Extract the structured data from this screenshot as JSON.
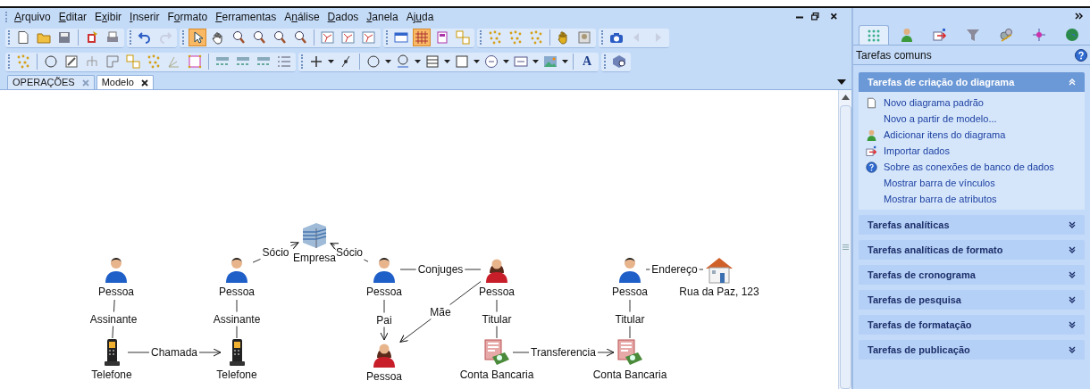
{
  "menu": [
    {
      "access_key": "A",
      "rest": "rquivo"
    },
    {
      "access_key": "E",
      "rest": "ditar"
    },
    {
      "before": "E",
      "access_key": "x",
      "rest": "ibir"
    },
    {
      "access_key": "I",
      "rest": "nserir"
    },
    {
      "before": "F",
      "access_key": "o",
      "rest": "rmato"
    },
    {
      "access_key": "F",
      "rest": "erramentas"
    },
    {
      "before": "A",
      "access_key": "n",
      "rest": "álise"
    },
    {
      "access_key": "D",
      "rest": "ados"
    },
    {
      "access_key": "J",
      "rest": "anela"
    },
    {
      "before": "Aj",
      "access_key": "u",
      "rest": "da"
    }
  ],
  "main_toolbar": [
    {
      "pressed": false,
      "disabled": false
    },
    {
      "pressed": false,
      "disabled": false
    },
    {
      "pressed": false,
      "disabled": false
    },
    {
      "pressed": false,
      "disabled": false
    },
    {
      "pressed": false,
      "disabled": false
    },
    {
      "pressed": false,
      "disabled": false
    },
    {
      "pressed": false,
      "disabled": true
    },
    {
      "pressed": true,
      "disabled": false
    },
    {
      "pressed": false,
      "disabled": false
    },
    {
      "pressed": false,
      "disabled": false
    },
    {
      "pressed": false,
      "disabled": false
    },
    {
      "pressed": false,
      "disabled": false
    },
    {
      "pressed": false,
      "disabled": false
    },
    {
      "pressed": false,
      "disabled": false
    },
    {
      "pressed": false,
      "disabled": false
    },
    {
      "pressed": false,
      "disabled": false
    },
    {
      "pressed": false,
      "disabled": false
    },
    {
      "pressed": true,
      "disabled": false
    },
    {
      "pressed": false,
      "disabled": false
    },
    {
      "pressed": false,
      "disabled": false
    },
    {
      "pressed": false,
      "disabled": false
    },
    {
      "pressed": false,
      "disabled": false
    },
    {
      "pressed": false,
      "disabled": false
    },
    {
      "pressed": false,
      "disabled": false
    },
    {
      "pressed": false,
      "disabled": false
    },
    {
      "pressed": false,
      "disabled": false
    },
    {
      "pressed": false,
      "disabled": true
    },
    {
      "pressed": false,
      "disabled": true
    }
  ],
  "format_toolbar": {
    "font_button": "A"
  },
  "document_tabs": [
    {
      "label": "OPERAÇÕES",
      "selected": false
    },
    {
      "label": "Modelo",
      "selected": true
    }
  ],
  "diagram": {
    "nodes": [
      {
        "kind": "company",
        "label": "Empresa"
      },
      {
        "kind": "man",
        "label": "Pessoa"
      },
      {
        "kind": "man",
        "label": "Pessoa"
      },
      {
        "kind": "man",
        "label": "Pessoa"
      },
      {
        "kind": "woman",
        "label": "Pessoa"
      },
      {
        "kind": "man",
        "label": "Pessoa"
      },
      {
        "kind": "house",
        "label": "Rua da Paz, 123"
      },
      {
        "kind": "phone",
        "label": "Telefone"
      },
      {
        "kind": "phone",
        "label": "Telefone"
      },
      {
        "kind": "woman",
        "label": "Pessoa"
      },
      {
        "kind": "account",
        "label": "Conta Bancaria"
      },
      {
        "kind": "account",
        "label": "Conta Bancaria"
      }
    ],
    "edges": [
      {
        "label": "Sócio",
        "arrow": true
      },
      {
        "label": "Sócio",
        "arrow": true
      },
      {
        "label": "Conjuges",
        "arrow": false
      },
      {
        "label": "Endereço",
        "arrow": false
      },
      {
        "label": "Assinante",
        "arrow": false
      },
      {
        "label": "Assinante",
        "arrow": false
      },
      {
        "label": "Pai",
        "arrow": true
      },
      {
        "label": "Mãe",
        "arrow": true
      },
      {
        "label": "Titular",
        "arrow": false
      },
      {
        "label": "Titular",
        "arrow": false
      },
      {
        "label": "Chamada",
        "arrow": true
      },
      {
        "label": "Transferencia",
        "arrow": true
      }
    ]
  },
  "task_pane": {
    "tabs": [
      {
        "selected": true
      },
      {
        "selected": false
      },
      {
        "selected": false
      },
      {
        "selected": false
      },
      {
        "selected": false
      },
      {
        "selected": false
      },
      {
        "selected": false
      }
    ],
    "title": "Tarefas comuns",
    "sections": [
      {
        "title": "Tarefas de criação do diagrama",
        "expanded": true,
        "items": [
          {
            "kind": "document",
            "label": "Novo diagrama padrão"
          },
          {
            "kind": "plain",
            "label": "Novo a partir de modelo..."
          },
          {
            "kind": "person",
            "label": "Adicionar itens do diagrama"
          },
          {
            "kind": "import",
            "label": "Importar dados"
          },
          {
            "kind": "help",
            "label": "Sobre as conexões de banco de dados"
          },
          {
            "kind": "plain",
            "label": "Mostrar barra de vínculos"
          },
          {
            "kind": "plain",
            "label": "Mostrar barra de atributos"
          }
        ]
      },
      {
        "title": "Tarefas analíticas",
        "expanded": false
      },
      {
        "title": "Tarefas analíticas de formato",
        "expanded": false
      },
      {
        "title": "Tarefas de cronograma",
        "expanded": false
      },
      {
        "title": "Tarefas de pesquisa",
        "expanded": false
      },
      {
        "title": "Tarefas de formatação",
        "expanded": false
      },
      {
        "title": "Tarefas de publicação",
        "expanded": false
      }
    ]
  }
}
